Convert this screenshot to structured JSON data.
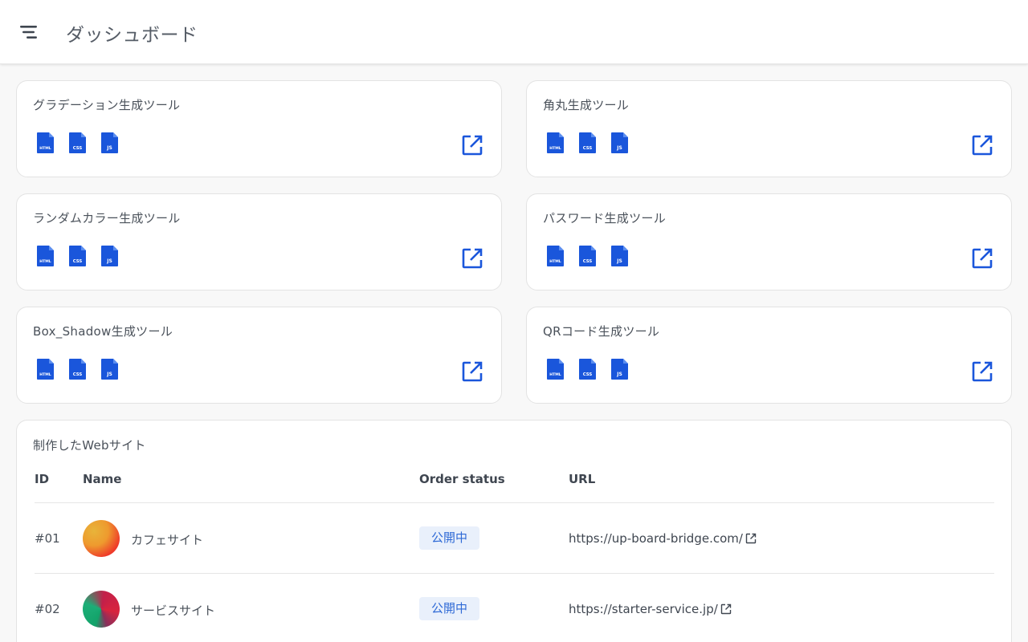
{
  "header": {
    "title": "ダッシュボード",
    "menu_icon": "menu-icon"
  },
  "colors": {
    "accent": "#1a56db",
    "badge_bg": "#e9f0fb",
    "badge_text": "#2f6ad6"
  },
  "tools": [
    {
      "title": "グラデーション生成ツール",
      "files": [
        "HTML",
        "CSS",
        "JS"
      ]
    },
    {
      "title": "角丸生成ツール",
      "files": [
        "HTML",
        "CSS",
        "JS"
      ]
    },
    {
      "title": "ランダムカラー生成ツール",
      "files": [
        "HTML",
        "CSS",
        "JS"
      ]
    },
    {
      "title": "パスワード生成ツール",
      "files": [
        "HTML",
        "CSS",
        "JS"
      ]
    },
    {
      "title": "Box_Shadow生成ツール",
      "files": [
        "HTML",
        "CSS",
        "JS"
      ]
    },
    {
      "title": "QRコード生成ツール",
      "files": [
        "HTML",
        "CSS",
        "JS"
      ]
    }
  ],
  "websites": {
    "title": "制作したWebサイト",
    "columns": {
      "id": "ID",
      "name": "Name",
      "status": "Order status",
      "url": "URL"
    },
    "rows": [
      {
        "id": "#01",
        "name": "カフェサイト",
        "status": "公開中",
        "url": "https://up-board-bridge.com/"
      },
      {
        "id": "#02",
        "name": "サービスサイト",
        "status": "公開中",
        "url": "https://starter-service.jp/"
      }
    ]
  }
}
